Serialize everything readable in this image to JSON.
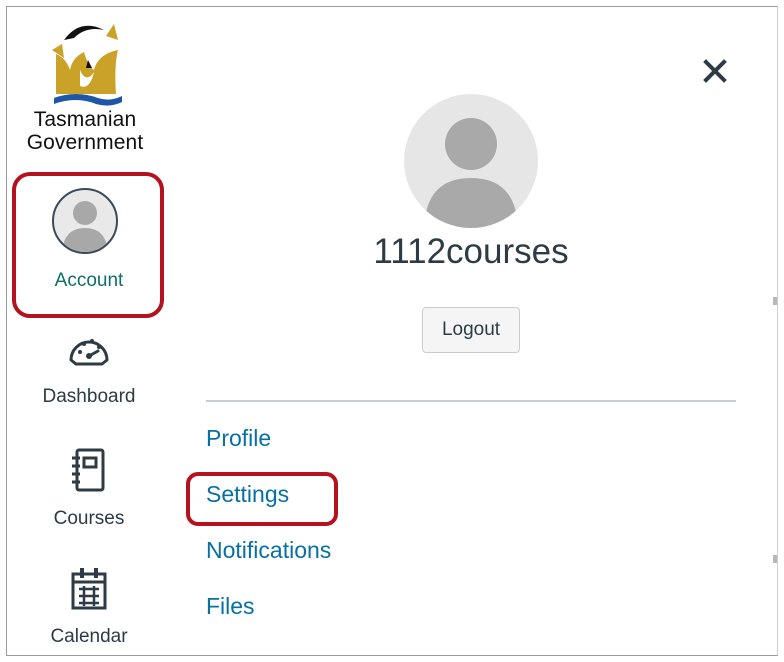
{
  "brand": {
    "line1": "Tasmanian",
    "line2": "Government"
  },
  "nav": {
    "account": "Account",
    "dashboard": "Dashboard",
    "courses": "Courses",
    "calendar": "Calendar"
  },
  "tray": {
    "username": "1112courses",
    "logout_label": "Logout",
    "links": {
      "profile": "Profile",
      "settings": "Settings",
      "notifications": "Notifications",
      "files": "Files"
    }
  },
  "colors": {
    "highlight": "#b3121e",
    "link": "#0770a3",
    "account_active": "#0e6f6a"
  },
  "icons": {
    "close": "close-icon",
    "avatar": "avatar-icon",
    "dashboard": "dashboard-icon",
    "courses": "courses-icon",
    "calendar": "calendar-icon"
  }
}
